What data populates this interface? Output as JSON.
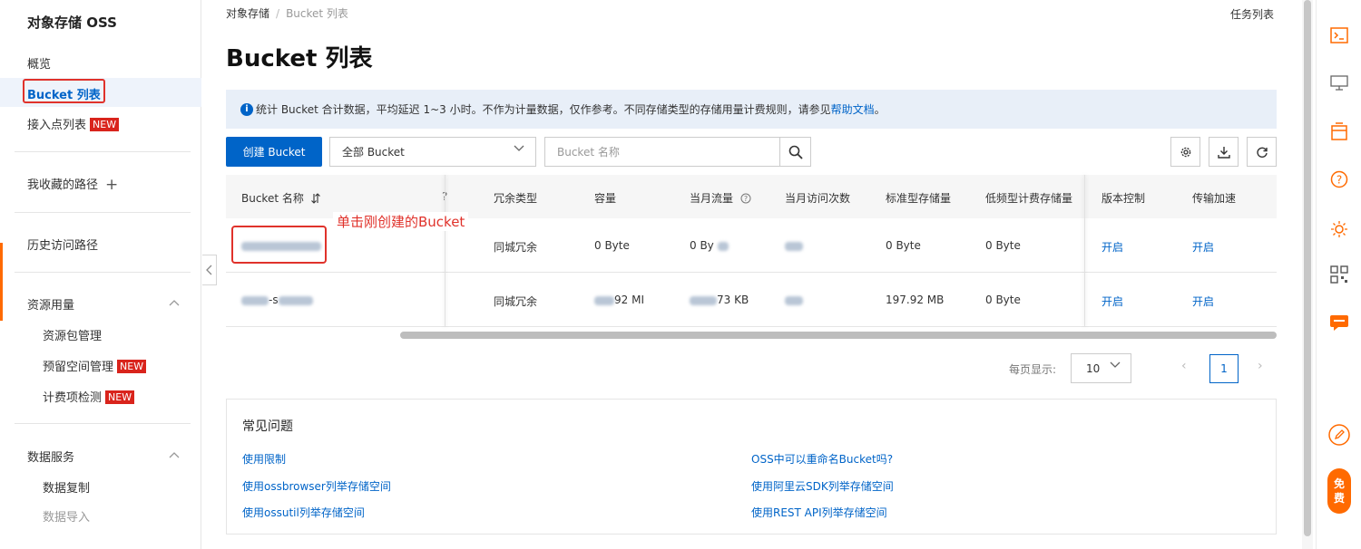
{
  "sidebar": {
    "title": "对象存储 OSS",
    "items": {
      "overview": "概览",
      "bucket_list": "Bucket 列表",
      "access_points": "接入点列表",
      "favorites": "我收藏的路径",
      "history": "历史访问路径",
      "resource_usage": "资源用量",
      "resource_pack": "资源包管理",
      "reserved_space": "预留空间管理",
      "billing_check": "计费项检测",
      "data_services": "数据服务",
      "data_replication": "数据复制",
      "data_import": "数据导入"
    },
    "new_badge": "NEW",
    "plus": "+"
  },
  "breadcrumb": {
    "root": "对象存储",
    "separator": "/",
    "current": "Bucket 列表"
  },
  "task_list": "任务列表",
  "page_title": "Bucket 列表",
  "notice": {
    "text": "统计 Bucket 合计数据，平均延迟 1~3 小时。不作为计量数据，仅作参考。不同存储类型的存储用量计费规则，请参见",
    "link": "帮助文档",
    "end": "。"
  },
  "toolbar": {
    "create_button": "创建 Bucket",
    "filter_value": "全部 Bucket",
    "search_placeholder": "Bucket 名称"
  },
  "table": {
    "headers": {
      "name": "Bucket 名称",
      "clipped": "?",
      "redundancy": "冗余类型",
      "capacity": "容量",
      "monthly_traffic": "当月流量",
      "monthly_requests": "当月访问次数",
      "standard_storage": "标准型存储量",
      "ia_storage": "低频型计费存储量",
      "versioning": "版本控制",
      "transfer_accel": "传输加速"
    },
    "rows": [
      {
        "redundancy": "同城冗余",
        "capacity": "0 Byte",
        "traffic_suffix": "0 By",
        "standard": "0 Byte",
        "ia": "0 Byte",
        "versioning": "开启",
        "accel": "开启"
      },
      {
        "name_mid": "-s",
        "redundancy": "同城冗余",
        "capacity_suffix": "92 MI",
        "traffic_suffix": "73 KB",
        "standard": "197.92 MB",
        "ia": "0 Byte",
        "versioning": "开启",
        "accel": "开启"
      }
    ]
  },
  "annotation": "单击刚创建的Bucket",
  "pagination": {
    "label": "每页显示:",
    "page_size": "10",
    "prev": "‹",
    "next": "›",
    "current_page": "1"
  },
  "faq": {
    "title": "常见问题",
    "links": [
      "使用限制",
      "OSS中可以重命名Bucket吗?",
      "使用ossbrowser列举存储空间",
      "使用阿里云SDK列举存储空间",
      "使用ossutil列举存储空间",
      "使用REST API列举存储空间"
    ]
  },
  "rail": {
    "free_1": "免",
    "free_2": "费"
  },
  "colors": {
    "primary": "#0064c8",
    "accent": "#ff6a00",
    "alert": "#e0322b"
  },
  "icons": [
    "terminal-icon",
    "monitor-icon",
    "coupon-icon",
    "help-icon",
    "sun-icon",
    "qrcode-icon",
    "chat-icon",
    "edit-icon",
    "search-icon",
    "settings-icon",
    "download-icon",
    "refresh-icon",
    "info-icon",
    "sort-icon"
  ]
}
